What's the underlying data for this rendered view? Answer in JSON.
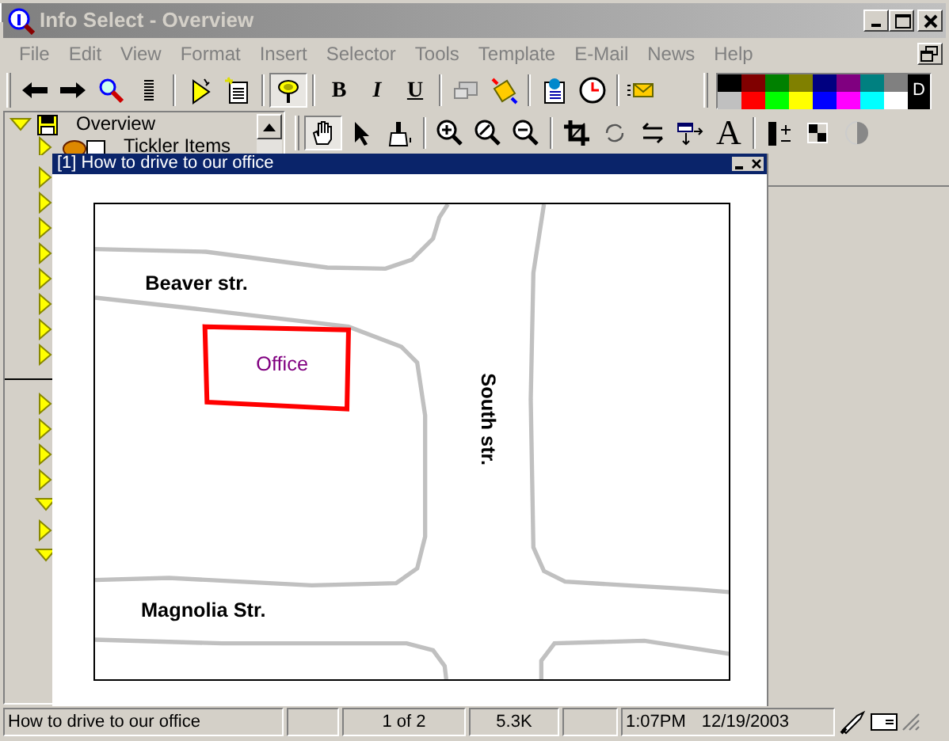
{
  "window": {
    "title": "Info Select - Overview",
    "active": false
  },
  "menu": [
    "File",
    "Edit",
    "View",
    "Format",
    "Insert",
    "Selector",
    "Tools",
    "Template",
    "E-Mail",
    "News",
    "Help"
  ],
  "toolbar": {
    "pin_selected": true,
    "format_buttons": [
      {
        "label": "B",
        "kind": "bold"
      },
      {
        "label": "I",
        "kind": "italic"
      },
      {
        "label": "U",
        "kind": "underline"
      }
    ]
  },
  "palette": {
    "colors": [
      {
        "color": "#000000"
      },
      {
        "color": "#800000"
      },
      {
        "color": "#008000"
      },
      {
        "color": "#808000"
      },
      {
        "color": "#000080"
      },
      {
        "color": "#800080"
      },
      {
        "color": "#008080"
      },
      {
        "color": "#808080"
      },
      {
        "color": "#c0c0c0"
      },
      {
        "color": "#ff0000"
      },
      {
        "color": "#00ff00"
      },
      {
        "color": "#ffff00"
      },
      {
        "color": "#0000ff"
      },
      {
        "color": "#ff00ff"
      },
      {
        "color": "#00ffff"
      },
      {
        "color": "#ffffff"
      }
    ],
    "default_label": "D"
  },
  "tree": {
    "items": [
      {
        "label": "Overview",
        "expanded": true
      },
      {
        "label": "Tickler Items",
        "expanded": false
      }
    ],
    "hidden_rows_top": [
      {
        "expanded": false
      },
      {
        "expanded": false
      },
      {
        "expanded": false
      },
      {
        "expanded": false
      },
      {
        "expanded": false
      },
      {
        "expanded": false
      },
      {
        "expanded": false
      },
      {
        "expanded": false
      }
    ],
    "hidden_rows_bottom": [
      {
        "expanded": false
      },
      {
        "expanded": false
      },
      {
        "expanded": false
      },
      {
        "expanded": false
      },
      {
        "expanded": true
      },
      {
        "expanded": false
      },
      {
        "expanded": true
      }
    ]
  },
  "drawing_toolbar": {
    "hand_selected": true,
    "text_tool": "A"
  },
  "note_window": {
    "title": "[1] How to drive to our office",
    "map": {
      "labels": [
        {
          "text": "Beaver str.",
          "kind": "street"
        },
        {
          "text": "Office",
          "kind": "place"
        },
        {
          "text": "South str.",
          "kind": "street_vertical"
        },
        {
          "text": "Magnolia Str.",
          "kind": "street_lower"
        }
      ]
    }
  },
  "status_bar": {
    "note": "How to drive to our office",
    "position": "1 of 2",
    "size": "5.3K",
    "time": "1:07PM",
    "date": "12/19/2003"
  }
}
